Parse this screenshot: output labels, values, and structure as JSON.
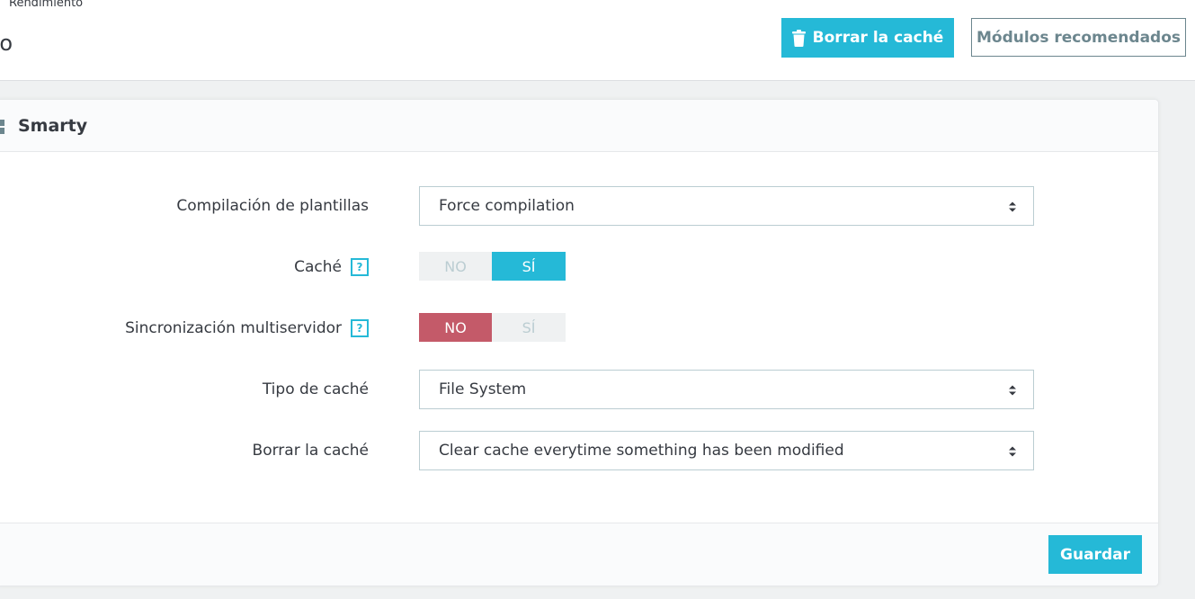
{
  "header": {
    "breadcrumb": "Rendimiento",
    "title_fragment": "to",
    "clear_cache_label": "Borrar la caché",
    "recommended_modules_label": "Módulos recomendados"
  },
  "panel": {
    "title": "Smarty",
    "fields": {
      "template_compilation": {
        "label": "Compilación de plantillas",
        "value": "Force compilation"
      },
      "cache": {
        "label": "Caché",
        "help": "?",
        "no_label": "NO",
        "yes_label": "SÍ",
        "selected": "SÍ"
      },
      "multiserver_sync": {
        "label": "Sincronización multiservidor",
        "help": "?",
        "no_label": "NO",
        "yes_label": "SÍ",
        "selected": "NO"
      },
      "cache_type": {
        "label": "Tipo de caché",
        "value": "File System"
      },
      "clear_cache": {
        "label": "Borrar la caché",
        "value": "Clear cache everytime something has been modified"
      }
    },
    "save_label": "Guardar"
  },
  "colors": {
    "accent": "#25b9d7",
    "danger": "#c45a69",
    "text": "#363a41",
    "muted": "#6c868e",
    "border": "#bbcdd2"
  },
  "icons": {
    "clear_cache_button": "trash-icon",
    "panel_heading": "puzzle-icon",
    "select_caret": "sort-caret-icon"
  }
}
